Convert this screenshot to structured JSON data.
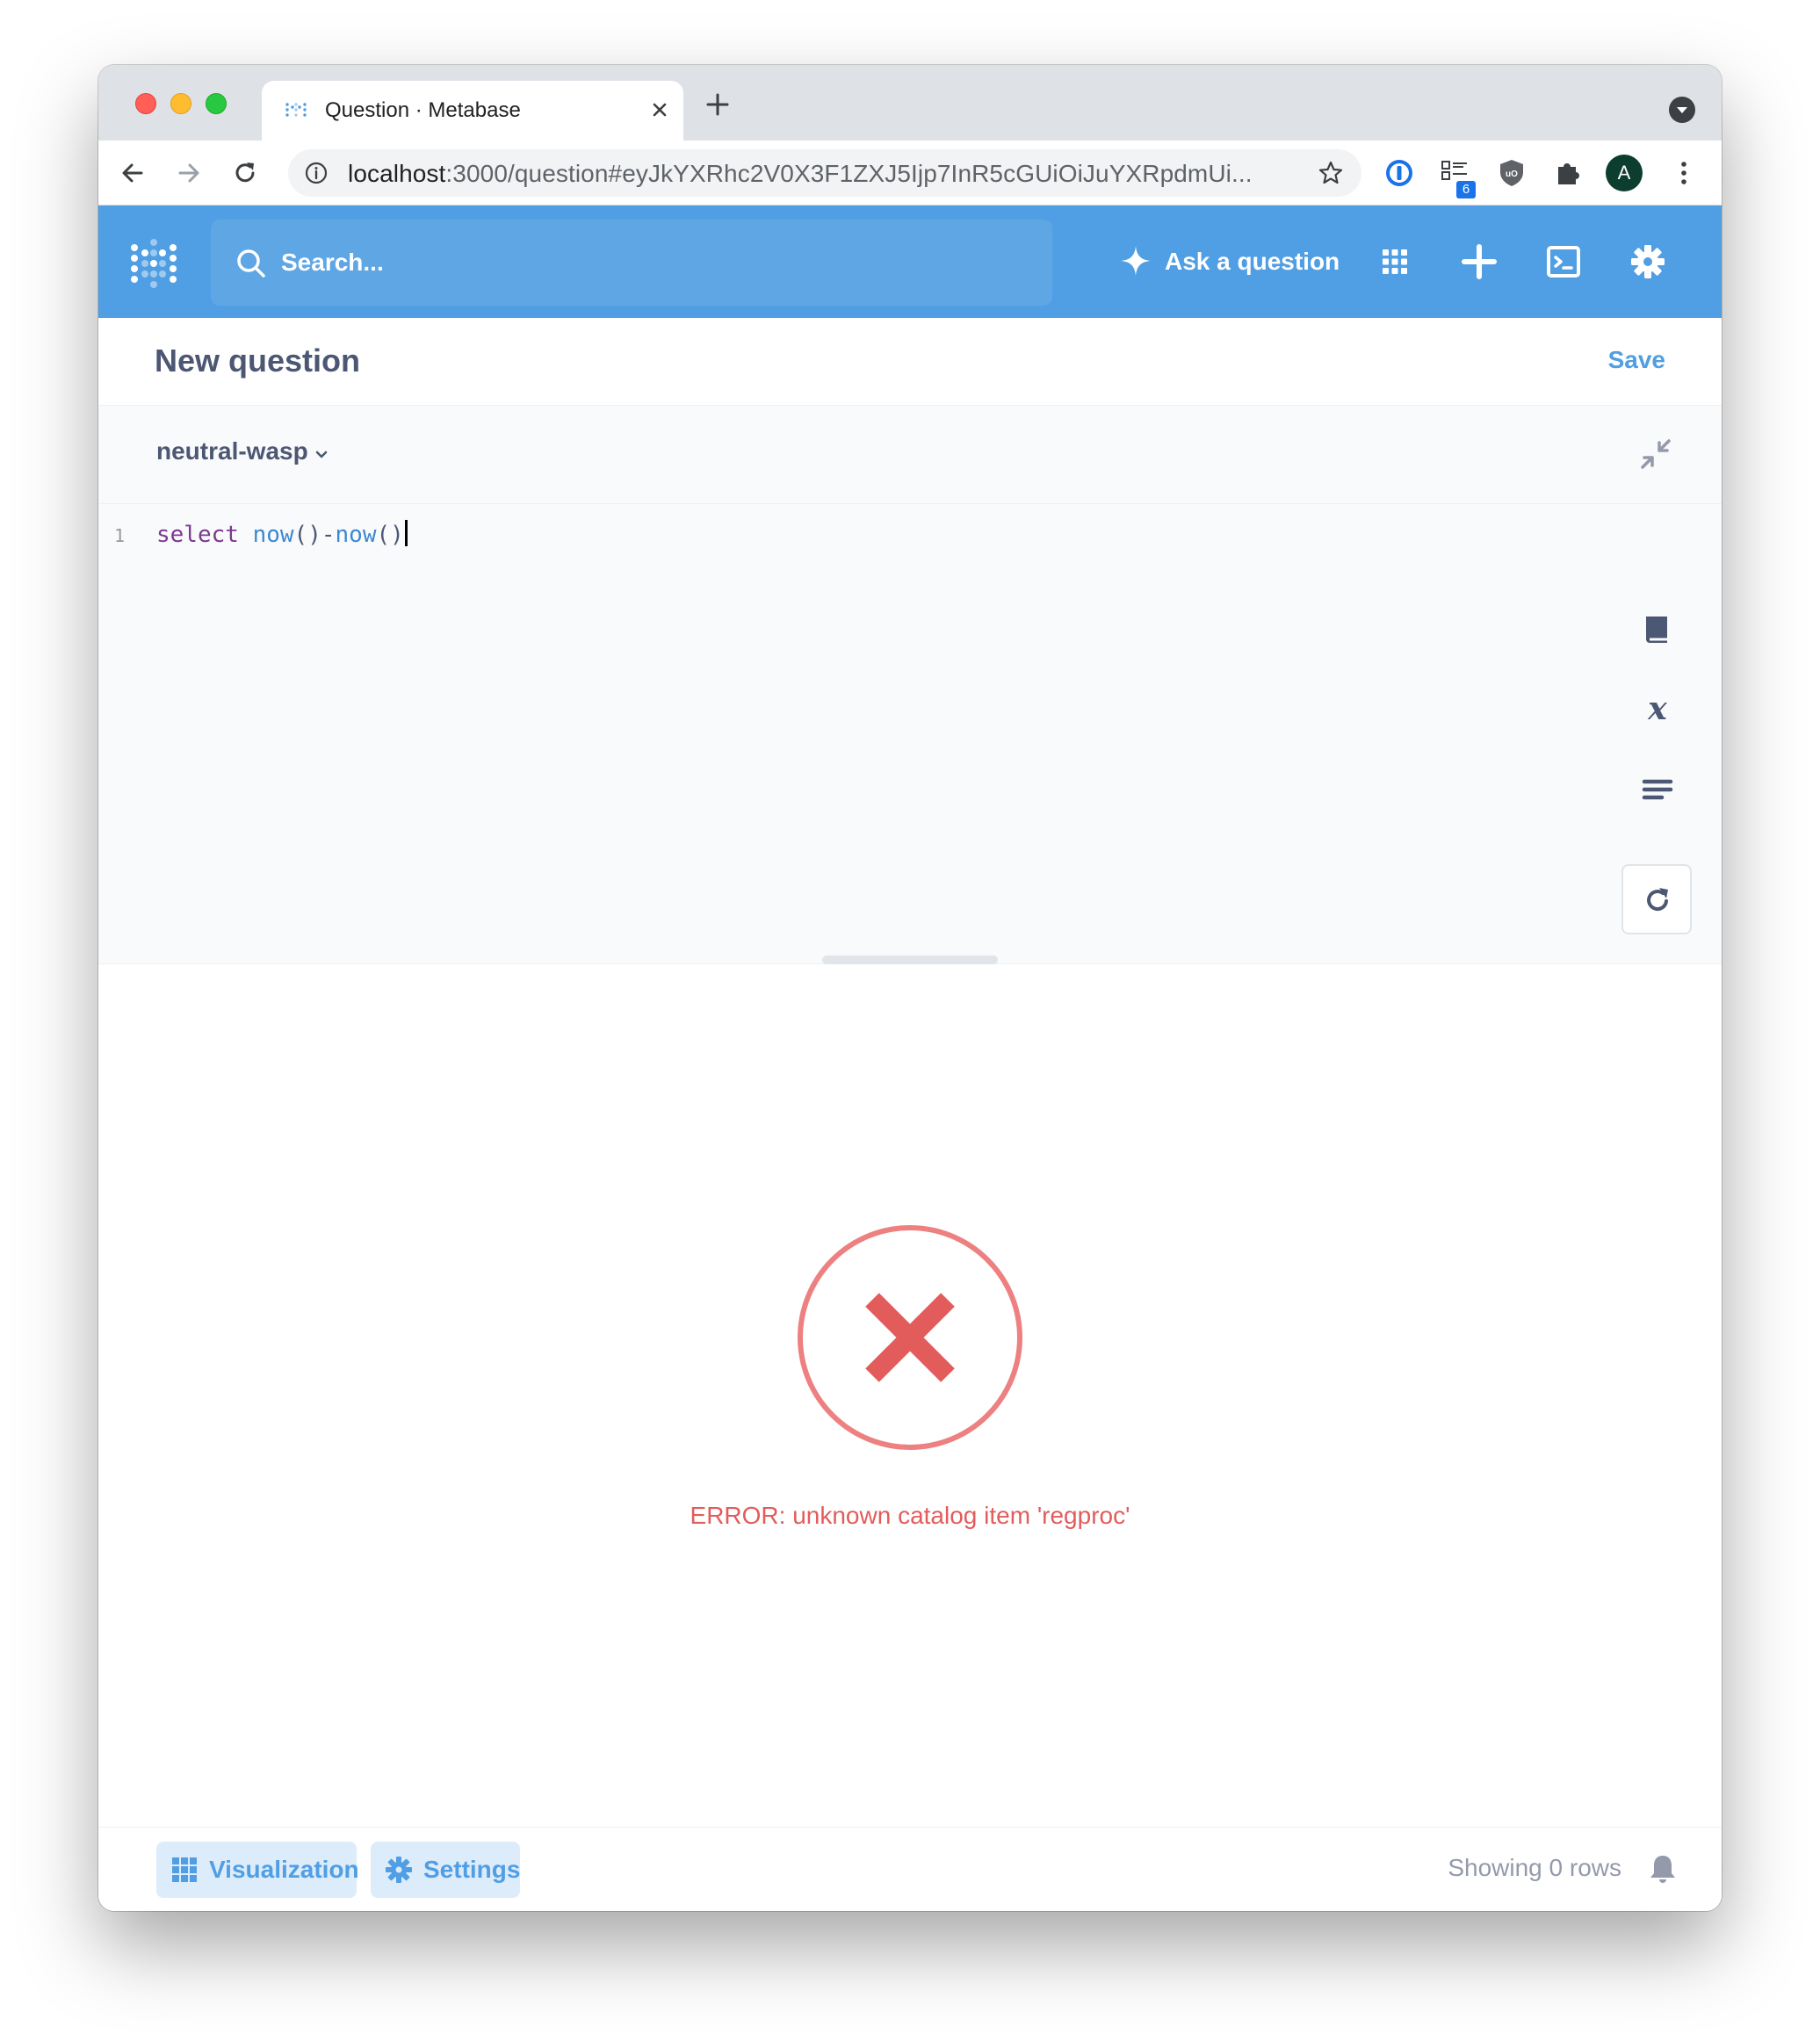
{
  "browser": {
    "tab_title": "Question · Metabase",
    "url_host": "localhost",
    "url_rest": ":3000/question#eyJkYXRhc2V0X3F1ZXJ5Ijp7InR5cGUiOiJuYXRpdmUi...",
    "extension_badge": "6",
    "profile_initial": "A",
    "icons": [
      "back-arrow-icon",
      "forward-arrow-icon",
      "reload-icon",
      "info-icon",
      "star-icon",
      "password-manager-icon",
      "tab-extension-icon",
      "shield-icon",
      "puzzle-icon",
      "kebab-menu-icon"
    ]
  },
  "nav": {
    "search_placeholder": "Search...",
    "ask_label": "Ask a question",
    "brand_color": "#509ee3"
  },
  "question": {
    "title": "New question",
    "save_label": "Save"
  },
  "editor": {
    "database": "neutral-wasp",
    "line_number": "1",
    "code_keyword": "select",
    "code_fn1": "now",
    "code_p1": "()-",
    "code_fn2": "now",
    "code_p2": "()"
  },
  "result": {
    "error_message": "ERROR: unknown catalog item 'regproc'",
    "error_color": "#e35c5c"
  },
  "footer": {
    "visualization_label": "Visualization",
    "settings_label": "Settings",
    "row_count": "Showing 0 rows"
  }
}
